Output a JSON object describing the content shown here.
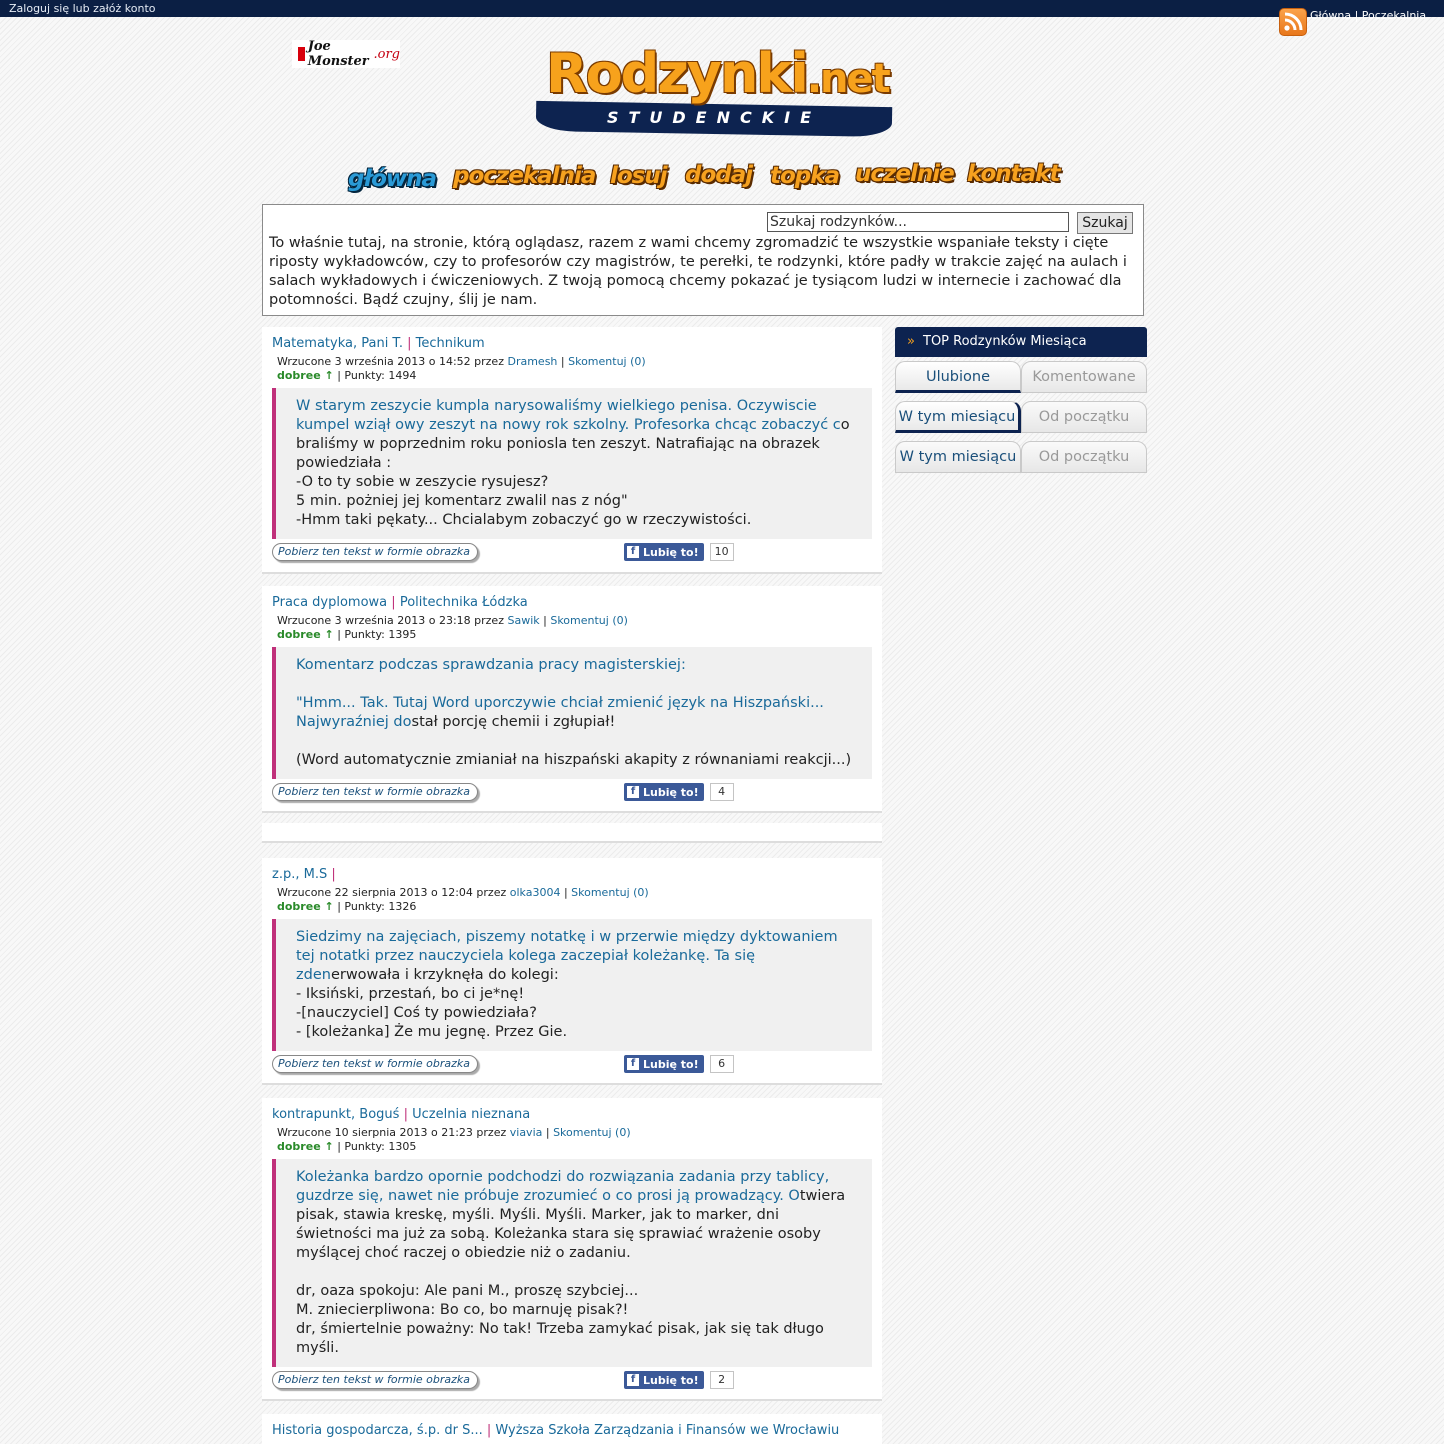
{
  "topbar": {
    "text": "Zaloguj się lub załóż konto"
  },
  "toplinks": {
    "text": "Główna | Poczekalnia"
  },
  "partner": {
    "name": "Joe Monster",
    "suffix": ".org"
  },
  "logo": {
    "word": "Rodzynki",
    "tld": ".net",
    "sub": "STUDENCKIE"
  },
  "nav": [
    "główna",
    "poczekalnia",
    "losuj",
    "dodaj",
    "topka",
    "uczelnie",
    "kontakt"
  ],
  "search": {
    "placeholder": "Szukaj rodzynków...",
    "button": "Szukaj"
  },
  "intro": "To właśnie tutaj, na stronie, którą oglądasz, razem z wami chcemy zgromadzić te wszystkie wspaniałe teksty i cięte riposty wykładowców, czy to profesorów czy magistrów, te perełki, te rodzynki, które padły w trakcie zajęć na aulach i salach wykładowych i ćwiczeniowych. Z twoją pomocą chcemy pokazać je tysiącom ludzi w internecie i zachować dla potomności. Bądź czujny, ślij je nam.",
  "common": {
    "download": "Pobierz ten tekst w formie obrazka",
    "like": "Lubię to!",
    "good": "dobree ↑",
    "uploaded": "Wrzucone",
    "by": "przez",
    "points_label": "Punkty:"
  },
  "posts": [
    {
      "category": "Matematyka, Pani T.",
      "school": "Technikum",
      "date": "3 września 2013 o 14:52",
      "author": "Dramesh",
      "comments": "Skomentuj (0)",
      "points": "1494",
      "lead": "W starym zeszycie kumpla narysowaliśmy wielkiego penisa. Oczywiscie kumpel wziął owy zeszyt na nowy rok szkolny. Profesorka chcąc zobaczyć c",
      "text": "o braliśmy w poprzednim roku poniosla ten zeszyt. Natrafiając na obrazek powiedziała :\n-O to ty sobie w zeszycie rysujesz?\n5 min. pożniej jej komentarz zwalil nas z nóg\"\n-Hmm taki pękaty... Chcialabym zobaczyć go w rzeczywistości.",
      "likes": "10"
    },
    {
      "category": "Praca dyplomowa",
      "school": "Politechnika Łódzka",
      "date": "3 września 2013 o 23:18",
      "author": "Sawik",
      "comments": "Skomentuj (0)",
      "points": "1395",
      "lead": "Komentarz podczas sprawdzania pracy magisterskiej:\n\n\"Hmm... Tak. Tutaj Word uporczywie chciał zmienić język na Hiszpański... Najwyraźniej do",
      "text": "stał porcję chemii i zgłupiał!\n\n(Word automatycznie zmianiał na hiszpański akapity z równaniami reakcji...)",
      "likes": "4"
    },
    {
      "category": "z.p., M.S",
      "school": "",
      "date": "22 sierpnia 2013 o 12:04",
      "author": "olka3004",
      "comments": "Skomentuj (0)",
      "points": "1326",
      "lead": "Siedzimy na zajęciach, piszemy notatkę i w przerwie między dyktowaniem tej notatki przez nauczyciela kolega zaczepiał koleżankę. Ta się zden",
      "text": "erwowała i krzyknęła do kolegi:\n- Iksiński, przestań, bo ci je*nę!\n-[nauczyciel] Coś ty powiedziała?\n- [koleżanka] Że mu jegnę. Przez Gie.",
      "likes": "6"
    },
    {
      "category": "kontrapunkt, Boguś",
      "school": "Uczelnia nieznana",
      "date": "10 sierpnia 2013 o 21:23",
      "author": "viavia",
      "comments": "Skomentuj (0)",
      "points": "1305",
      "lead": "Koleżanka bardzo opornie podchodzi do rozwiązania zadania przy tablicy, guzdrze się, nawet nie próbuje zrozumieć o co prosi ją prowadzący. O",
      "text": "twiera pisak, stawia kreskę, myśli. Myśli. Myśli. Marker, jak to marker, dni świetności ma już za sobą. Koleżanka stara się sprawiać wrażenie osoby myślącej choć raczej o obiedzie niż o zadaniu.\n\ndr, oaza spokoju: Ale pani M., proszę szybciej...\nM. zniecierpliwona: Bo co, bo marnuję pisak?!\ndr, śmiertelnie poważny: No tak! Trzeba zamykać pisak, jak się tak długo myśli.",
      "likes": "2"
    },
    {
      "category": "Historia gospodarcza, ś.p. dr S...",
      "school": "Wyższa Szkoła Zarządzania i Finansów we Wrocławiu"
    }
  ],
  "sidebar": {
    "title": "TOP Rodzynków Miesiąca",
    "tabs1": [
      "Ulubione",
      "Komentowane"
    ],
    "tabs2": [
      "W tym miesiącu",
      "Od początku"
    ],
    "tabs3": [
      "W tym miesiącu",
      "Od początku"
    ]
  },
  "colors": {
    "navy": "#0d2350",
    "accent_pink": "#c0307a",
    "link": "#1a6a9a",
    "nav_orange": "#f6a11f",
    "fb_blue": "#3b5998"
  },
  "icons": {
    "rss": "rss-icon",
    "sidebar_head": "arrows-icon",
    "fb": "facebook-icon"
  }
}
